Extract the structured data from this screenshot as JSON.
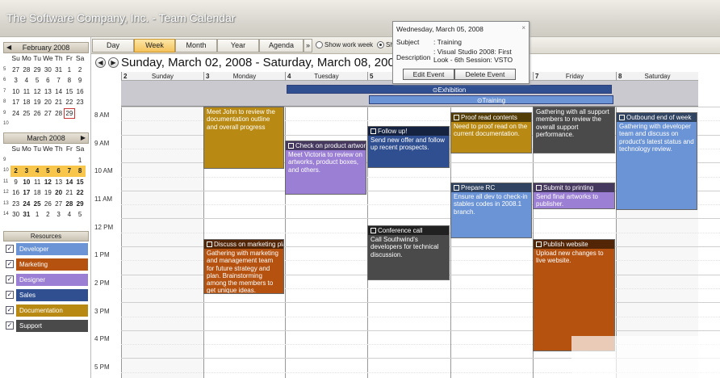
{
  "window": {
    "title": "The Software Company, Inc. - Team Calendar"
  },
  "minical_feb": {
    "title": "February 2008",
    "dow": [
      "Su",
      "Mo",
      "Tu",
      "We",
      "Th",
      "Fr",
      "Sa"
    ],
    "weeks": [
      {
        "wk": "5",
        "days": [
          "27",
          "28",
          "29",
          "30",
          "31",
          "1",
          "2"
        ]
      },
      {
        "wk": "6",
        "days": [
          "3",
          "4",
          "5",
          "6",
          "7",
          "8",
          "9"
        ]
      },
      {
        "wk": "7",
        "days": [
          "10",
          "11",
          "12",
          "13",
          "14",
          "15",
          "16"
        ]
      },
      {
        "wk": "8",
        "days": [
          "17",
          "18",
          "19",
          "20",
          "21",
          "22",
          "23"
        ]
      },
      {
        "wk": "9",
        "days": [
          "24",
          "25",
          "26",
          "27",
          "28",
          "29",
          ""
        ]
      },
      {
        "wk": "10",
        "days": [
          "",
          "",
          "",
          "",
          "",
          "",
          ""
        ]
      }
    ]
  },
  "minical_mar": {
    "title": "March 2008",
    "dow": [
      "Su",
      "Mo",
      "Tu",
      "We",
      "Th",
      "Fr",
      "Sa"
    ],
    "weeks": [
      {
        "wk": "9",
        "days": [
          "",
          "",
          "",
          "",
          "",
          "",
          "1"
        ]
      },
      {
        "wk": "10",
        "days": [
          "2",
          "3",
          "4",
          "5",
          "6",
          "7",
          "8"
        ]
      },
      {
        "wk": "11",
        "days": [
          "9",
          "10",
          "11",
          "12",
          "13",
          "14",
          "15"
        ]
      },
      {
        "wk": "12",
        "days": [
          "16",
          "17",
          "18",
          "19",
          "20",
          "21",
          "22"
        ]
      },
      {
        "wk": "13",
        "days": [
          "23",
          "24",
          "25",
          "26",
          "27",
          "28",
          "29"
        ]
      },
      {
        "wk": "14",
        "days": [
          "30",
          "31",
          "1",
          "2",
          "3",
          "4",
          "5"
        ]
      }
    ]
  },
  "resources": {
    "title": "Resources",
    "items": [
      {
        "label": "Developer",
        "color": "#6b94d6"
      },
      {
        "label": "Marketing",
        "color": "#b5520f"
      },
      {
        "label": "Designer",
        "color": "#9b7fd4"
      },
      {
        "label": "Sales",
        "color": "#2f4f91"
      },
      {
        "label": "Documentation",
        "color": "#b98a13"
      },
      {
        "label": "Support",
        "color": "#4a4a4a"
      }
    ]
  },
  "toolbar": {
    "day": "Day",
    "week": "Week",
    "month": "Month",
    "year": "Year",
    "agenda": "Agenda",
    "more": "»",
    "work_week": "Show work week",
    "show_truncated": "Sh"
  },
  "nav": {
    "prev": "◀",
    "next": "▶",
    "range": "Sunday, March 02, 2008 - Saturday, March 08, 2008"
  },
  "days": [
    {
      "num": "2",
      "name": "Sunday"
    },
    {
      "num": "3",
      "name": "Monday"
    },
    {
      "num": "4",
      "name": "Tuesday"
    },
    {
      "num": "5",
      "name": ""
    },
    {
      "num": "",
      "name": ""
    },
    {
      "num": "7",
      "name": "Friday"
    },
    {
      "num": "8",
      "name": "Saturday"
    }
  ],
  "times": [
    "8 AM",
    "9 AM",
    "10 AM",
    "11 AM",
    "12 PM",
    "1 PM",
    "2 PM",
    "3 PM",
    "4 PM",
    "5 PM"
  ],
  "allday": [
    {
      "label": "Exhibition",
      "icon": "⊙"
    },
    {
      "label": "Training",
      "icon": "⊙"
    }
  ],
  "events": [
    {
      "head": "",
      "body": "Meet John to review the documentation outline and overall progress",
      "color": "#b98a13"
    },
    {
      "head": "Check on product artwork",
      "body": "Meet Victoria to review on artworks, product boxes, and others.",
      "color": "#9b7fd4"
    },
    {
      "head": "Discuss on marketing plan",
      "body": "Gathering with marketing and management team for future strategy and plan. Brainstorming among the members to get unique ideas.",
      "color": "#b5520f"
    },
    {
      "head": "Follow up!",
      "body": "Send new offer and follow up recent prospects.",
      "color": "#2f4f91"
    },
    {
      "head": "Conference call",
      "body": "Call Southwind's developers for technical discussion.",
      "color": "#4a4a4a"
    },
    {
      "head": "Proof read contents",
      "body": "Need to proof read on the current documentation.",
      "color": "#b98a13"
    },
    {
      "head": "Prepare RC",
      "body": "Ensure all dev to check-in stables codes in 2008.1 branch.",
      "color": "#6b94d6"
    },
    {
      "head": "",
      "body": "Gathering with all support members to review the overall support performance.",
      "color": "#4a4a4a"
    },
    {
      "head": "Submit to printing",
      "body": "Send final artworks to publisher.",
      "color": "#9b7fd4"
    },
    {
      "head": "Publish website",
      "body": "Upload new changes to live website.",
      "color": "#b5520f"
    },
    {
      "head": "Outbound end of week",
      "body": "Gathering with developer team and discuss on product's latest status and technology review.",
      "color": "#6b94d6"
    }
  ],
  "tooltip": {
    "date": "Wednesday, March 05, 2008",
    "subject_label": "Subject",
    "subject": ": Training",
    "desc_label": "Description",
    "desc": ": Visual Studio 2008: First Look - 6th Session: VSTO",
    "close": "×",
    "edit": "Edit Event",
    "delete": "Delete Event"
  }
}
